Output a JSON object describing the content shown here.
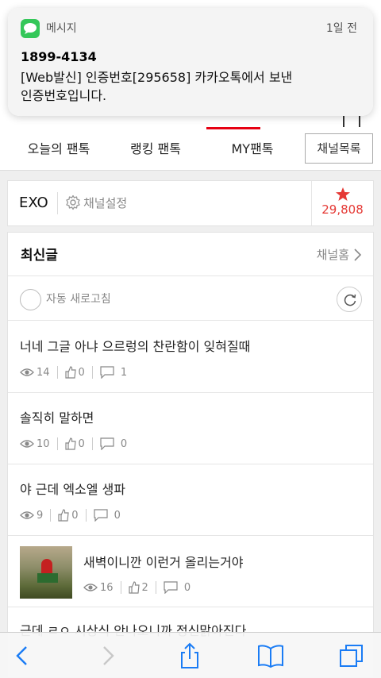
{
  "notification": {
    "app_name": "메시지",
    "time": "1일 전",
    "sender": "1899-4134",
    "body_line1": "[Web발신] 인증번호[295658] 카카오톡에서 보낸",
    "body_line2": "인증번호입니다."
  },
  "nav": {
    "tabs": [
      {
        "label": "오늘의 팬톡"
      },
      {
        "label": "랭킹 팬톡"
      },
      {
        "label": "MY팬톡"
      }
    ],
    "active_tab": "MY팬톡",
    "channel_list": "채널목록",
    "accent_color": "#e60012"
  },
  "channel": {
    "name": "EXO",
    "settings_label": "채널설정",
    "star_count": "29,808",
    "star_color": "#e53935"
  },
  "latest": {
    "title": "최신글",
    "channel_home": "채널홈",
    "auto_refresh_label": "자동 새로고침"
  },
  "posts": [
    {
      "title": "너네 그글 아냐 으르렁의 찬란함이 잊혀질때",
      "views": "14",
      "likes": "0",
      "comments": "1"
    },
    {
      "title": "솔직히 말하면",
      "views": "10",
      "likes": "0",
      "comments": "0"
    },
    {
      "title": "야 근데 엑소엘 생파",
      "views": "9",
      "likes": "0",
      "comments": "0"
    },
    {
      "title": "새벽이니깐 이런거 올리는거야",
      "views": "16",
      "likes": "2",
      "comments": "0",
      "has_thumbnail": true
    },
    {
      "title": "근데 ㄹㅇ 시상식 안나오니까 정신맑아진다"
    }
  ],
  "toolbar": {
    "icons": [
      "back-icon",
      "forward-icon",
      "share-icon",
      "bookmarks-icon",
      "tabs-icon"
    ]
  }
}
